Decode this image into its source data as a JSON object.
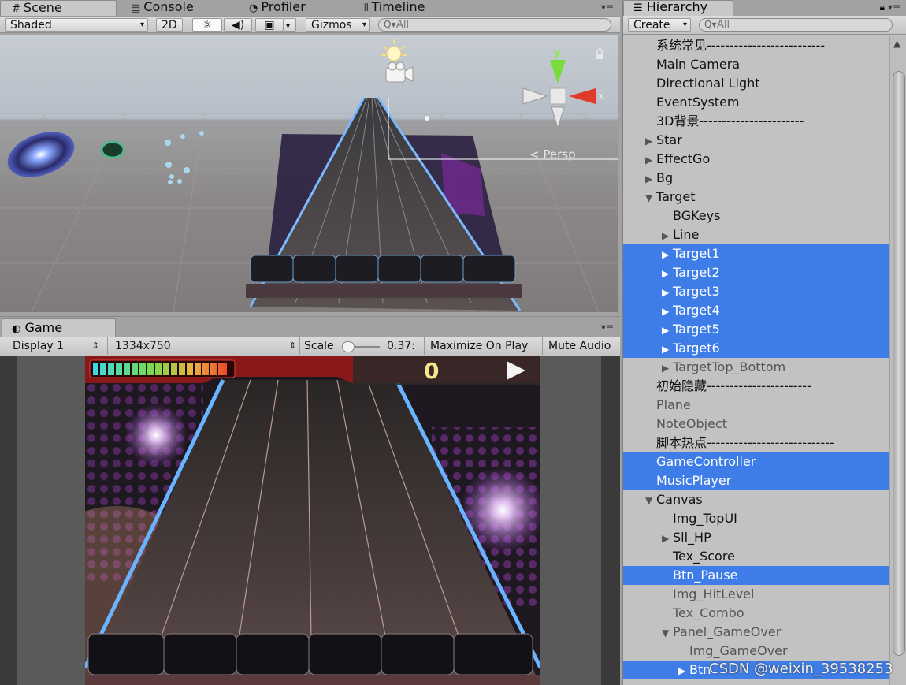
{
  "scene_panel": {
    "tabs": [
      {
        "label": "Scene",
        "icon": "hash-icon",
        "active": true
      },
      {
        "label": "Console",
        "icon": "console-icon",
        "active": false
      },
      {
        "label": "Profiler",
        "icon": "profiler-icon",
        "active": false
      },
      {
        "label": "Timeline",
        "icon": "timeline-icon",
        "active": false
      }
    ],
    "toolbar": {
      "shading_mode": "Shaded",
      "mode_2d": "2D",
      "gizmos": "Gizmos",
      "search_placeholder": "All"
    },
    "persp_label": "Persp"
  },
  "game_panel": {
    "tab_label": "Game",
    "toolbar": {
      "display": "Display 1",
      "resolution": "1334x750",
      "scale_label": "Scale",
      "scale_value": "0.37:",
      "maximize": "Maximize On Play",
      "mute": "Mute Audio"
    },
    "score": "0"
  },
  "hierarchy": {
    "tab_label": "Hierarchy",
    "create_label": "Create",
    "search_placeholder": "All",
    "items": [
      {
        "label": "系统常见--------------------------",
        "indent": 0,
        "arrow": "",
        "selected": false,
        "dim": false
      },
      {
        "label": "Main Camera",
        "indent": 0,
        "arrow": "",
        "selected": false,
        "dim": false
      },
      {
        "label": "Directional Light",
        "indent": 0,
        "arrow": "",
        "selected": false,
        "dim": false
      },
      {
        "label": "EventSystem",
        "indent": 0,
        "arrow": "",
        "selected": false,
        "dim": false
      },
      {
        "label": "3D背景-----------------------",
        "indent": 0,
        "arrow": "",
        "selected": false,
        "dim": false
      },
      {
        "label": "Star",
        "indent": 0,
        "arrow": "▶",
        "selected": false,
        "dim": false
      },
      {
        "label": "EffectGo",
        "indent": 0,
        "arrow": "▶",
        "selected": false,
        "dim": false
      },
      {
        "label": "Bg",
        "indent": 0,
        "arrow": "▶",
        "selected": false,
        "dim": false
      },
      {
        "label": "Target",
        "indent": 0,
        "arrow": "▼",
        "selected": false,
        "dim": false
      },
      {
        "label": "BGKeys",
        "indent": 1,
        "arrow": "",
        "selected": false,
        "dim": false
      },
      {
        "label": "Line",
        "indent": 1,
        "arrow": "▶",
        "selected": false,
        "dim": false
      },
      {
        "label": "Target1",
        "indent": 1,
        "arrow": "▶",
        "selected": true,
        "dim": false
      },
      {
        "label": "Target2",
        "indent": 1,
        "arrow": "▶",
        "selected": true,
        "dim": false
      },
      {
        "label": "Target3",
        "indent": 1,
        "arrow": "▶",
        "selected": true,
        "dim": false
      },
      {
        "label": "Target4",
        "indent": 1,
        "arrow": "▶",
        "selected": true,
        "dim": false
      },
      {
        "label": "Target5",
        "indent": 1,
        "arrow": "▶",
        "selected": true,
        "dim": false
      },
      {
        "label": "Target6",
        "indent": 1,
        "arrow": "▶",
        "selected": true,
        "dim": false
      },
      {
        "label": "TargetTop_Bottom",
        "indent": 1,
        "arrow": "▶",
        "selected": false,
        "dim": true
      },
      {
        "label": "初始隐藏-----------------------",
        "indent": 0,
        "arrow": "",
        "selected": false,
        "dim": false
      },
      {
        "label": "Plane",
        "indent": 0,
        "arrow": "",
        "selected": false,
        "dim": true
      },
      {
        "label": "NoteObject",
        "indent": 0,
        "arrow": "",
        "selected": false,
        "dim": true
      },
      {
        "label": "脚本热点----------------------------",
        "indent": 0,
        "arrow": "",
        "selected": false,
        "dim": false
      },
      {
        "label": "GameController",
        "indent": 0,
        "arrow": "",
        "selected": true,
        "dim": false
      },
      {
        "label": "MusicPlayer",
        "indent": 0,
        "arrow": "",
        "selected": true,
        "dim": false
      },
      {
        "label": "Canvas",
        "indent": 0,
        "arrow": "▼",
        "selected": false,
        "dim": false
      },
      {
        "label": "Img_TopUI",
        "indent": 1,
        "arrow": "",
        "selected": false,
        "dim": false
      },
      {
        "label": "Sli_HP",
        "indent": 1,
        "arrow": "▶",
        "selected": false,
        "dim": false
      },
      {
        "label": "Tex_Score",
        "indent": 1,
        "arrow": "",
        "selected": false,
        "dim": false
      },
      {
        "label": "Btn_Pause",
        "indent": 1,
        "arrow": "",
        "selected": true,
        "dim": false
      },
      {
        "label": "Img_HitLevel",
        "indent": 1,
        "arrow": "",
        "selected": false,
        "dim": true
      },
      {
        "label": "Tex_Combo",
        "indent": 1,
        "arrow": "",
        "selected": false,
        "dim": true
      },
      {
        "label": "Panel_GameOver",
        "indent": 1,
        "arrow": "▼",
        "selected": false,
        "dim": true
      },
      {
        "label": "Img_GameOver",
        "indent": 2,
        "arrow": "",
        "selected": false,
        "dim": true
      },
      {
        "label": "Btn",
        "indent": 2,
        "arrow": "▶",
        "selected": true,
        "dim": false
      }
    ]
  },
  "watermark": "CSDN @weixin_39538253",
  "colors": {
    "selection": "#3e7de7",
    "panel_bg": "#c2c2c2",
    "accent_blue": "#4aa0ff"
  }
}
